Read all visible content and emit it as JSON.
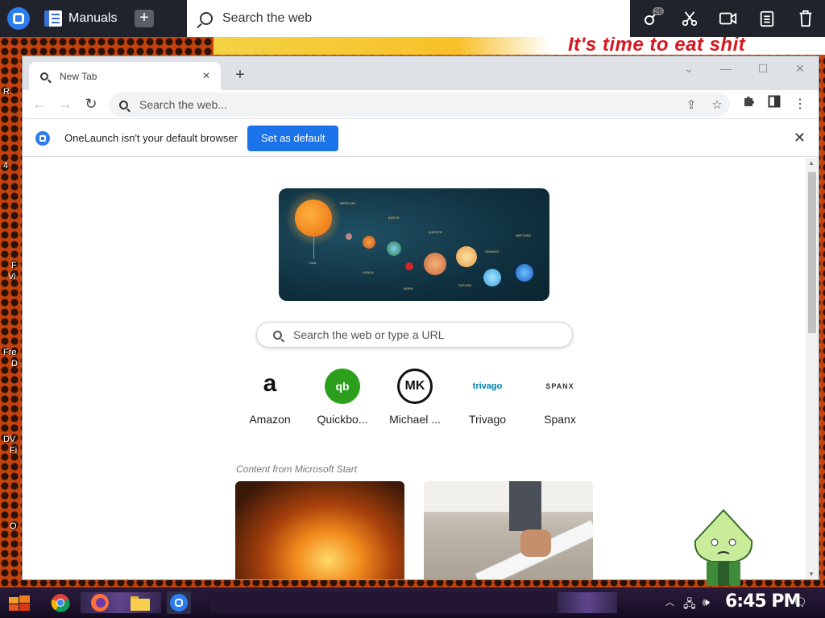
{
  "desktop": {
    "meme_text": "It's time to eat shit",
    "side_labels": [
      "R",
      "4",
      "F",
      "Vi",
      "Fre",
      "D",
      "DV",
      "Fi",
      "O"
    ]
  },
  "onelaunch_bar": {
    "app_name": "Manuals",
    "search_placeholder": "Search the web",
    "badge_count": "26"
  },
  "browser": {
    "tab_title": "New Tab",
    "address_placeholder": "Search the web...",
    "infobar_message": "OneLaunch isn't your default browser",
    "infobar_button": "Set as default"
  },
  "new_tab_page": {
    "search_placeholder": "Search the web or type a URL",
    "shortcuts": [
      {
        "label": "Amazon",
        "icon": "amazon-logo"
      },
      {
        "label": "Quickbo...",
        "icon": "quickbooks-logo"
      },
      {
        "label": "Michael ...",
        "icon": "michael-kors-logo"
      },
      {
        "label": "Trivago",
        "icon": "trivago-logo"
      },
      {
        "label": "Spanx",
        "icon": "spanx-logo"
      }
    ],
    "feed_label": "Content from Microsoft Start",
    "hero_planet_labels": [
      "MERCURY",
      "EARTH",
      "JUPITER",
      "URANUS",
      "NEPTUNE",
      "SUN",
      "VENUS",
      "MARS",
      "SATURN"
    ]
  },
  "shortcut_text": {
    "amazon": "a",
    "quickbooks": "qb",
    "michael_kors": "MK",
    "trivago": "trivago",
    "spanx": "SPANX"
  },
  "taskbar": {
    "clock": "6:45 PM"
  },
  "colors": {
    "accent_blue": "#1a73e8",
    "onelaunch_blue": "#2d7cf0",
    "topbar_bg": "#20232b"
  }
}
